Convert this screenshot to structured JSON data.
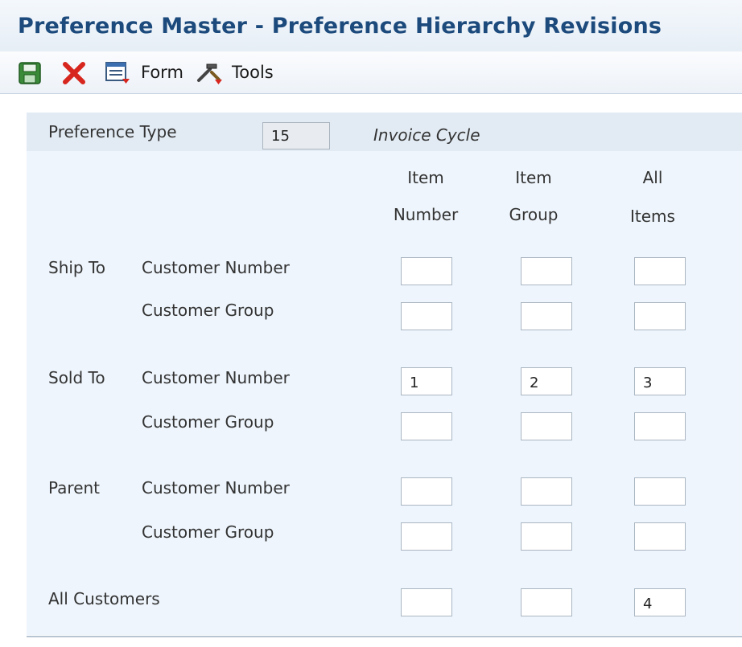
{
  "window": {
    "title": "Preference Master - Preference Hierarchy Revisions"
  },
  "toolbar": {
    "save_icon": "floppy-disk-icon",
    "cancel_icon": "red-x-icon",
    "form_label": "Form",
    "tools_label": "Tools"
  },
  "preference": {
    "type_label": "Preference Type",
    "type_value": "15",
    "type_description": "Invoice Cycle"
  },
  "columns": [
    {
      "line1": "Item",
      "line2": "Number"
    },
    {
      "line1": "Item",
      "line2": "Group"
    },
    {
      "line1": "All",
      "line2": "Items"
    }
  ],
  "groups": [
    {
      "label": "Ship To",
      "rows": [
        {
          "label": "Customer Number",
          "values": [
            "",
            "",
            ""
          ]
        },
        {
          "label": "Customer Group",
          "values": [
            "",
            "",
            ""
          ]
        }
      ]
    },
    {
      "label": "Sold To",
      "rows": [
        {
          "label": "Customer Number",
          "values": [
            "1",
            "2",
            "3"
          ]
        },
        {
          "label": "Customer Group",
          "values": [
            "",
            "",
            ""
          ]
        }
      ]
    },
    {
      "label": "Parent",
      "rows": [
        {
          "label": "Customer Number",
          "values": [
            "",
            "",
            ""
          ]
        },
        {
          "label": "Customer Group",
          "values": [
            "",
            "",
            ""
          ]
        }
      ]
    }
  ],
  "all_customers": {
    "label": "All Customers",
    "values": [
      "",
      "",
      "4"
    ]
  },
  "colors": {
    "title": "#1c4a7c",
    "panel": "#eef5fc",
    "cancel_red": "#d7261e"
  }
}
